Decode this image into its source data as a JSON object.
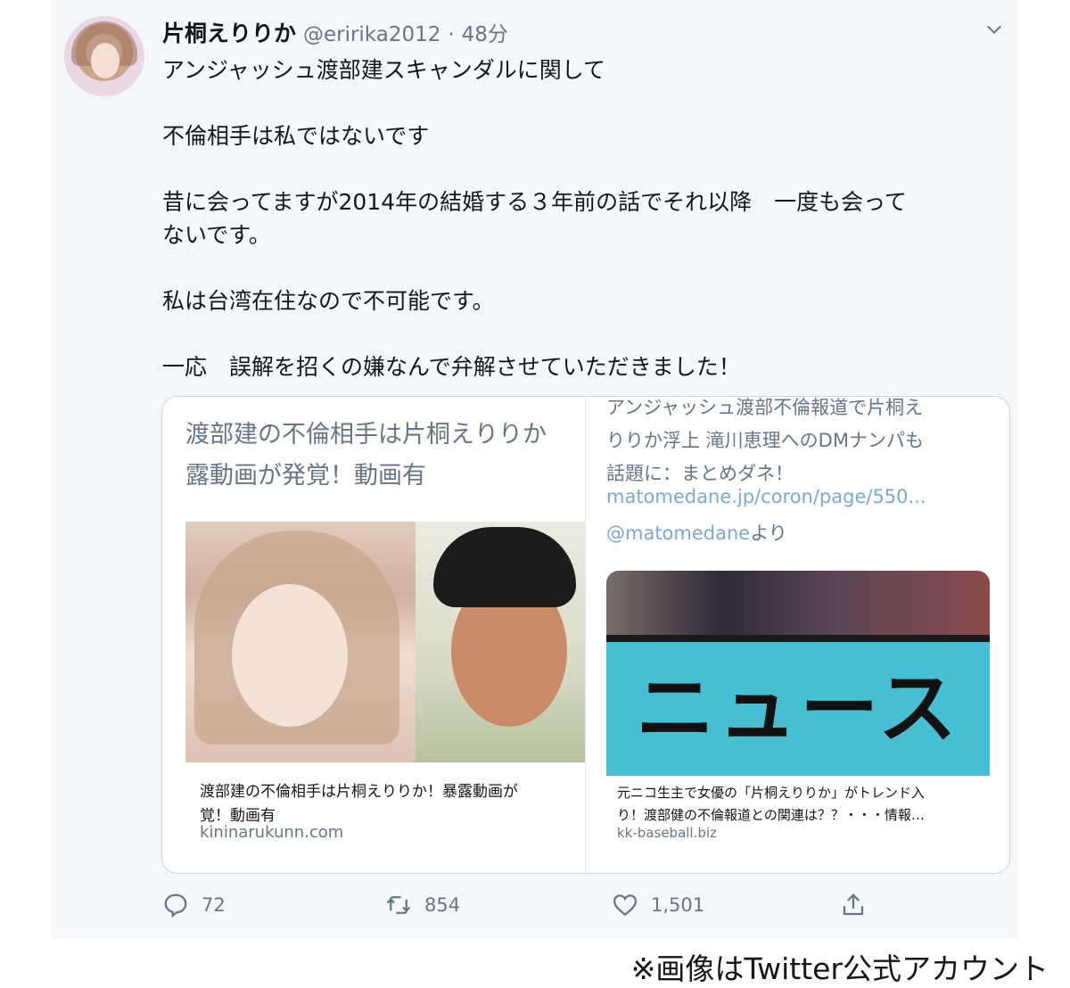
{
  "tweet": {
    "name": "片桐えりりか",
    "handle": "@eririka2012",
    "separator": "·",
    "time": "48分",
    "text": "アンジャッシュ渡部建スキャンダルに関して\n\n不倫相手は私ではないです\n\n昔に会ってますが2014年の結婚する３年前の話でそれ以降　一度も会って\nないです。\n\n私は台湾在住なので不可能です。\n\n一応　誤解を招くの嫌なんで弁解させていただきました！"
  },
  "quoted": {
    "left": {
      "title": "渡部建の不倫相手は片桐えりりか\n露動画が発覚！動画有",
      "caption": "渡部建の不倫相手は片桐えりりか！暴露動画が\n覚！動画有",
      "source": "kininarukunn.com"
    },
    "right": {
      "text": "アンジャッシュ渡部不倫報道で片桐え\nりりか浮上 滝川恵理へのDMナンパも\n話題に：まとめダネ！",
      "link": "matomedane.jp/coron/page/550...",
      "mention": "@matomedane",
      "mention_suffix": "より",
      "image_text": "ニュース",
      "caption": "元ニコ生主で女優の「片桐えりりか」がトレンド入\nり！渡部健の不倫報道との関連は？？・・・情報…",
      "source": "kk-baseball.biz"
    }
  },
  "actions": {
    "reply_count": "72",
    "retweet_count": "854",
    "like_count": "1,501"
  },
  "icons": {
    "reply": "reply-icon",
    "retweet": "retweet-icon",
    "like": "heart-icon",
    "share": "share-icon",
    "menu": "chevron-down-icon"
  },
  "footer_note": "※画像はTwitter公式アカウント"
}
